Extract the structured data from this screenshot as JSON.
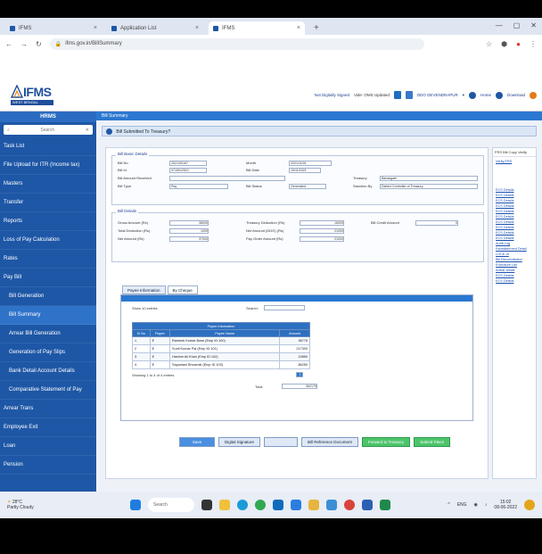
{
  "browser": {
    "tabs": [
      {
        "label": "IFMS"
      },
      {
        "label": "Application List"
      },
      {
        "label": "IFMS"
      }
    ],
    "url": "ifms.gov.in/BillSummary"
  },
  "header": {
    "logo": "IFMS",
    "logo_sub": "WEST BENGAL",
    "user": "Not Digitally Signed",
    "office_label": "Vide: OMS Updated",
    "ddo": "DDO DEVENDRAPUR",
    "home": "Home",
    "download": "Download"
  },
  "sidebar": {
    "title": "HRMS",
    "search_placeholder": "Search",
    "items": [
      {
        "label": "Task List"
      },
      {
        "label": "File Upload for ITR (Income tax)"
      },
      {
        "label": "Masters"
      },
      {
        "label": "Transfer"
      },
      {
        "label": "Reports"
      },
      {
        "label": "Loss of Pay Calculation"
      },
      {
        "label": "Rates"
      },
      {
        "label": "Pay Bill"
      },
      {
        "label": "Bill Generation"
      },
      {
        "label": "Bill Summary"
      },
      {
        "label": "Arrear Bill Generation"
      },
      {
        "label": "Generation of Pay Slips"
      },
      {
        "label": "Bank Detail Account Details"
      },
      {
        "label": "Comparative Statement of Pay"
      },
      {
        "label": "Arrear Trans"
      },
      {
        "label": "Employee Exit"
      },
      {
        "label": "Loan"
      },
      {
        "label": "Pension"
      }
    ]
  },
  "main": {
    "title": "Bill Summary",
    "subtitle": "Bill Submitted To Treasury?",
    "section1": "Bill Basic Details",
    "section2": "Bill Details",
    "fields": [
      {
        "label": "Bill No",
        "value": "2021/00167"
      },
      {
        "label": "Bill Id",
        "value": "0715012521"
      },
      {
        "label": "Bill Amount Received",
        "value": ""
      },
      {
        "label": "Month",
        "value": "2021/11/01"
      },
      {
        "label": "Bill Date",
        "value": "15/11/2021"
      },
      {
        "label": "Treasury",
        "value": "Banasgarh"
      },
      {
        "label": "Bill Month / Year",
        "value": "November / 2021"
      },
      {
        "label": "Head of Account",
        "value": "2054"
      },
      {
        "label": "Bill Type",
        "value": "Pay"
      },
      {
        "label": "Bill Status",
        "value": "Generated"
      },
      {
        "label": "Sanction By",
        "value": "District Controller of Treasury"
      },
      {
        "label": "Gross Amount (Rs)",
        "value": "38000"
      },
      {
        "label": "Total Deduction (Rs)",
        "value": "1000"
      },
      {
        "label": "Net Amount (Rs)",
        "value": "37000"
      },
      {
        "label": "Treasury Deduction (Rs)",
        "value": "16000"
      },
      {
        "label": "Net Amount (DDO) (Rs)",
        "value": "21000"
      },
      {
        "label": "Pay Order Amount (Rs)",
        "value": "21000"
      },
      {
        "label": "Bill Credit Amount",
        "value": "0"
      },
      {
        "label": "No of Employees",
        "value": "4"
      }
    ],
    "tabs": [
      "Payee Information",
      "By Cheque"
    ],
    "table": {
      "show_label": "Show 10 entries",
      "search_label": "Search:",
      "title": "Payee Information",
      "columns": [
        "Sl No",
        "Payee",
        "Payee Name",
        "Amount"
      ],
      "rows": [
        [
          "1",
          "E",
          "Ramesh Kumar Bose (Emp ID 100)",
          "38775"
        ],
        [
          "2",
          "E",
          "Sunil Kumar Pal (Emp ID 101)",
          "217300"
        ],
        [
          "3",
          "E",
          "Hashim Ali Khan (Emp ID 102)",
          "19850"
        ],
        [
          "4",
          "E",
          "Sayantani Bhowmik (Emp ID 103)",
          "86250"
        ]
      ],
      "info": "Showing 1 to 4 of 4 entries",
      "total_label": "Total",
      "total_value": "362175",
      "page": "1"
    },
    "buttons": {
      "save": "Save",
      "print": "Digital Signature",
      "blank": "",
      "bill_reference": "Bill Reference Document",
      "forward": "Forward to Treasury",
      "submit": "Submit Token"
    }
  },
  "right_panel": {
    "title": "FRS Bill Copy Verify",
    "links": [
      "Verify FRS",
      "ECS Details",
      "ECS Details",
      "ECS Details",
      "ECS Details",
      "ECS Details",
      "ECS Details",
      "ECS Details",
      "ECS Details",
      "ECS Details",
      "ECS Details",
      "Audit Log",
      "Establishment Detail",
      "LOCE-III",
      "Bill Reconciliation",
      "Enclosure List",
      "Arrear Detail",
      "ECS Details",
      "ECS Details"
    ]
  },
  "taskbar": {
    "weather_temp": "28°C",
    "weather_text": "Partly Cloudy",
    "search": "Search",
    "time": "15:02",
    "date": "08-06-2022",
    "lang": "ENG"
  }
}
